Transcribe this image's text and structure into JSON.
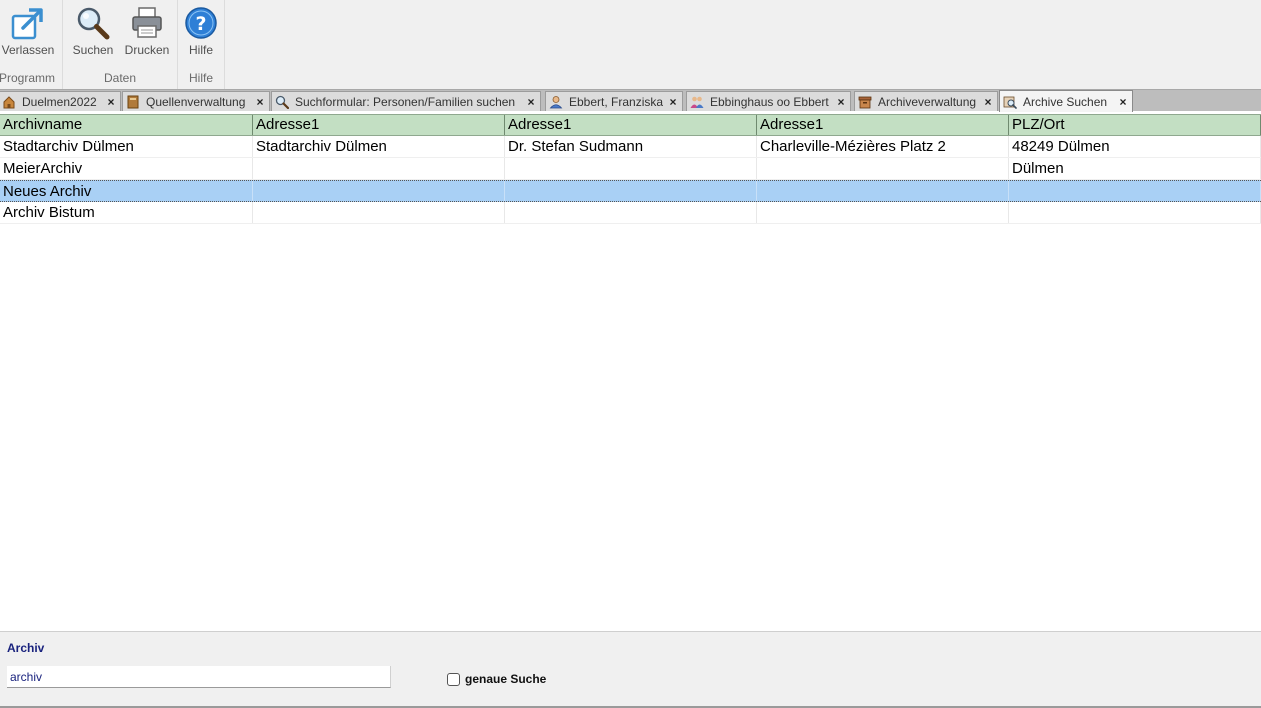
{
  "ribbon": {
    "groups": [
      {
        "label": "Programm",
        "buttons": [
          {
            "label": "Verlassen",
            "icon": "exit-arrow-icon"
          }
        ]
      },
      {
        "label": "Daten",
        "buttons": [
          {
            "label": "Suchen",
            "icon": "magnifier-icon"
          },
          {
            "label": "Drucken",
            "icon": "printer-icon"
          }
        ]
      },
      {
        "label": "Hilfe",
        "buttons": [
          {
            "label": "Hilfe",
            "icon": "help-icon"
          }
        ]
      }
    ]
  },
  "tabs": [
    {
      "label": "Duelmen2022",
      "icon": "house-icon"
    },
    {
      "label": "Quellenverwaltung",
      "icon": "book-icon"
    },
    {
      "label": "Suchformular: Personen/Familien suchen",
      "icon": "magnifier-icon"
    },
    {
      "label": "Ebbert, Franziska",
      "icon": "person-icon"
    },
    {
      "label": "Ebbinghaus oo Ebbert",
      "icon": "couple-icon"
    },
    {
      "label": "Archiveverwaltung",
      "icon": "archive-icon"
    },
    {
      "label": "Archive Suchen",
      "icon": "archive-search-icon",
      "active": true
    }
  ],
  "table": {
    "columns": [
      "Archivname",
      "Adresse1",
      "Adresse1",
      "Adresse1",
      "PLZ/Ort"
    ],
    "rows": [
      [
        "Stadtarchiv Dülmen",
        "Stadtarchiv Dülmen",
        "Dr. Stefan Sudmann",
        "Charleville-Mézières Platz 2",
        "48249 Dülmen"
      ],
      [
        "MeierArchiv",
        "",
        "",
        "",
        "Dülmen"
      ],
      [
        "Neues Archiv",
        "",
        "",
        "",
        ""
      ],
      [
        "Archiv Bistum",
        "",
        "",
        "",
        ""
      ]
    ],
    "selected_row": 2
  },
  "search": {
    "title": "Archiv",
    "value": "archiv",
    "exact_label": "genaue Suche",
    "exact_checked": false
  },
  "colors": {
    "header_bg": "#c3dfc3",
    "selected_bg": "#a9d0f5",
    "panel_title": "#1a237e"
  }
}
